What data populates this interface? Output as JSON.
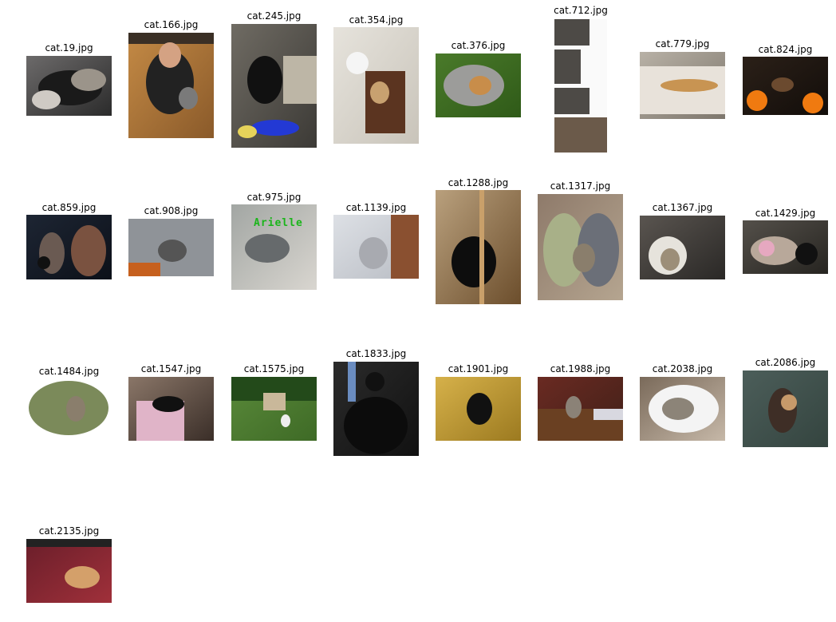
{
  "figure": {
    "images": [
      {
        "title": "cat.19.jpg"
      },
      {
        "title": "cat.166.jpg"
      },
      {
        "title": "cat.245.jpg"
      },
      {
        "title": "cat.354.jpg"
      },
      {
        "title": "cat.376.jpg"
      },
      {
        "title": "cat.712.jpg"
      },
      {
        "title": "cat.779.jpg"
      },
      {
        "title": "cat.824.jpg"
      },
      {
        "title": "cat.859.jpg"
      },
      {
        "title": "cat.908.jpg"
      },
      {
        "title": "cat.975.jpg",
        "overlay_text": "Arielle"
      },
      {
        "title": "cat.1139.jpg"
      },
      {
        "title": "cat.1288.jpg"
      },
      {
        "title": "cat.1317.jpg"
      },
      {
        "title": "cat.1367.jpg"
      },
      {
        "title": "cat.1429.jpg"
      },
      {
        "title": "cat.1484.jpg"
      },
      {
        "title": "cat.1547.jpg"
      },
      {
        "title": "cat.1575.jpg"
      },
      {
        "title": "cat.1833.jpg"
      },
      {
        "title": "cat.1901.jpg"
      },
      {
        "title": "cat.1988.jpg"
      },
      {
        "title": "cat.2038.jpg"
      },
      {
        "title": "cat.2086.jpg"
      },
      {
        "title": "cat.2135.jpg"
      }
    ]
  }
}
